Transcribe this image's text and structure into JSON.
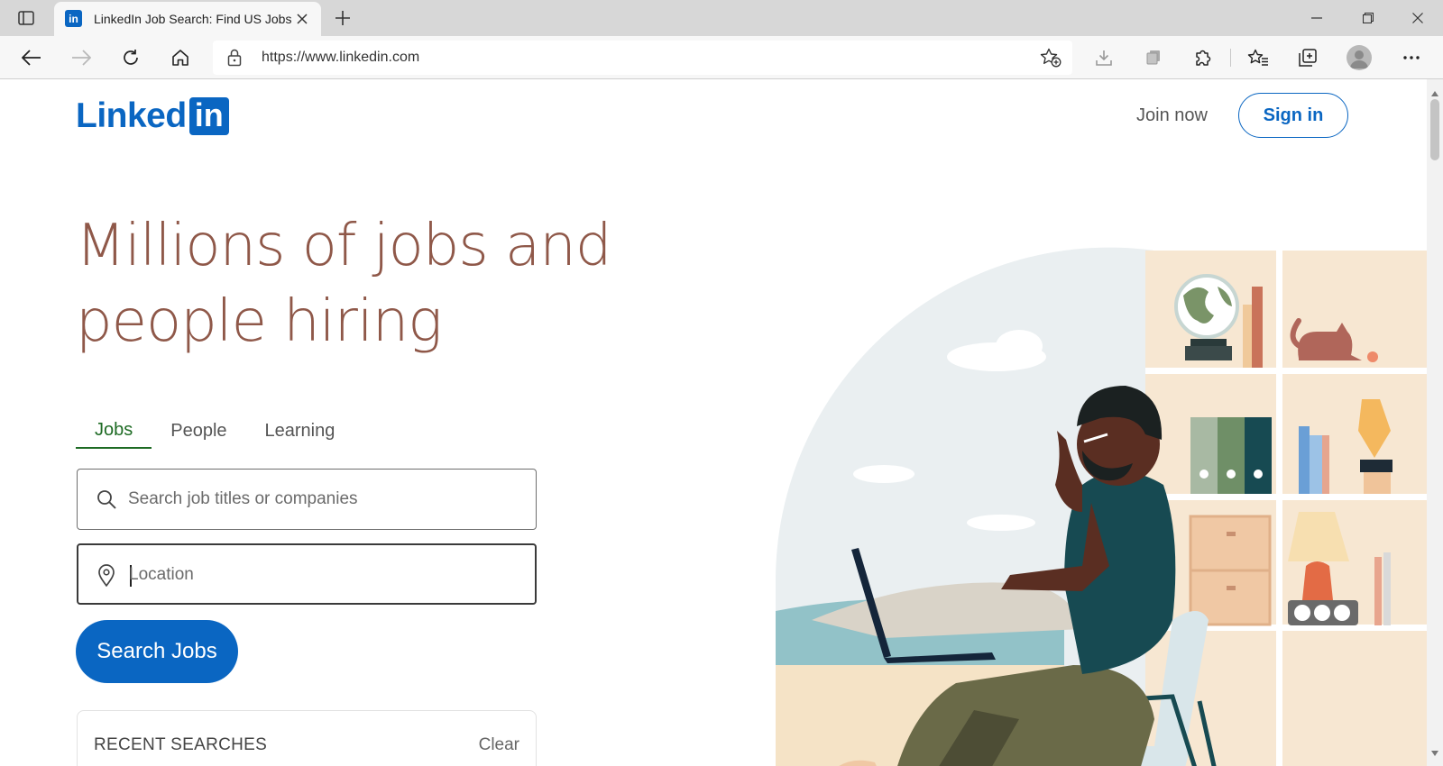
{
  "browser": {
    "tab_title": "LinkedIn Job Search: Find US Jobs",
    "favicon_text": "in",
    "url": "https://www.linkedin.com"
  },
  "header": {
    "logo_text": "Linked",
    "logo_box_text": "in",
    "join_now": "Join now",
    "sign_in": "Sign in"
  },
  "hero": {
    "headline_line1": "Millions of jobs and",
    "headline_line2": "people hiring"
  },
  "search_tabs": [
    {
      "label": "Jobs",
      "active": true
    },
    {
      "label": "People",
      "active": false
    },
    {
      "label": "Learning",
      "active": false
    }
  ],
  "search": {
    "keywords_placeholder": "Search job titles or companies",
    "location_placeholder": "Location",
    "button_label": "Search Jobs"
  },
  "recent_searches": {
    "title": "RECENT SEARCHES",
    "clear": "Clear"
  },
  "colors": {
    "brand": "#0a66c2",
    "headline": "#8f5849",
    "active_tab": "#1e6b24"
  }
}
